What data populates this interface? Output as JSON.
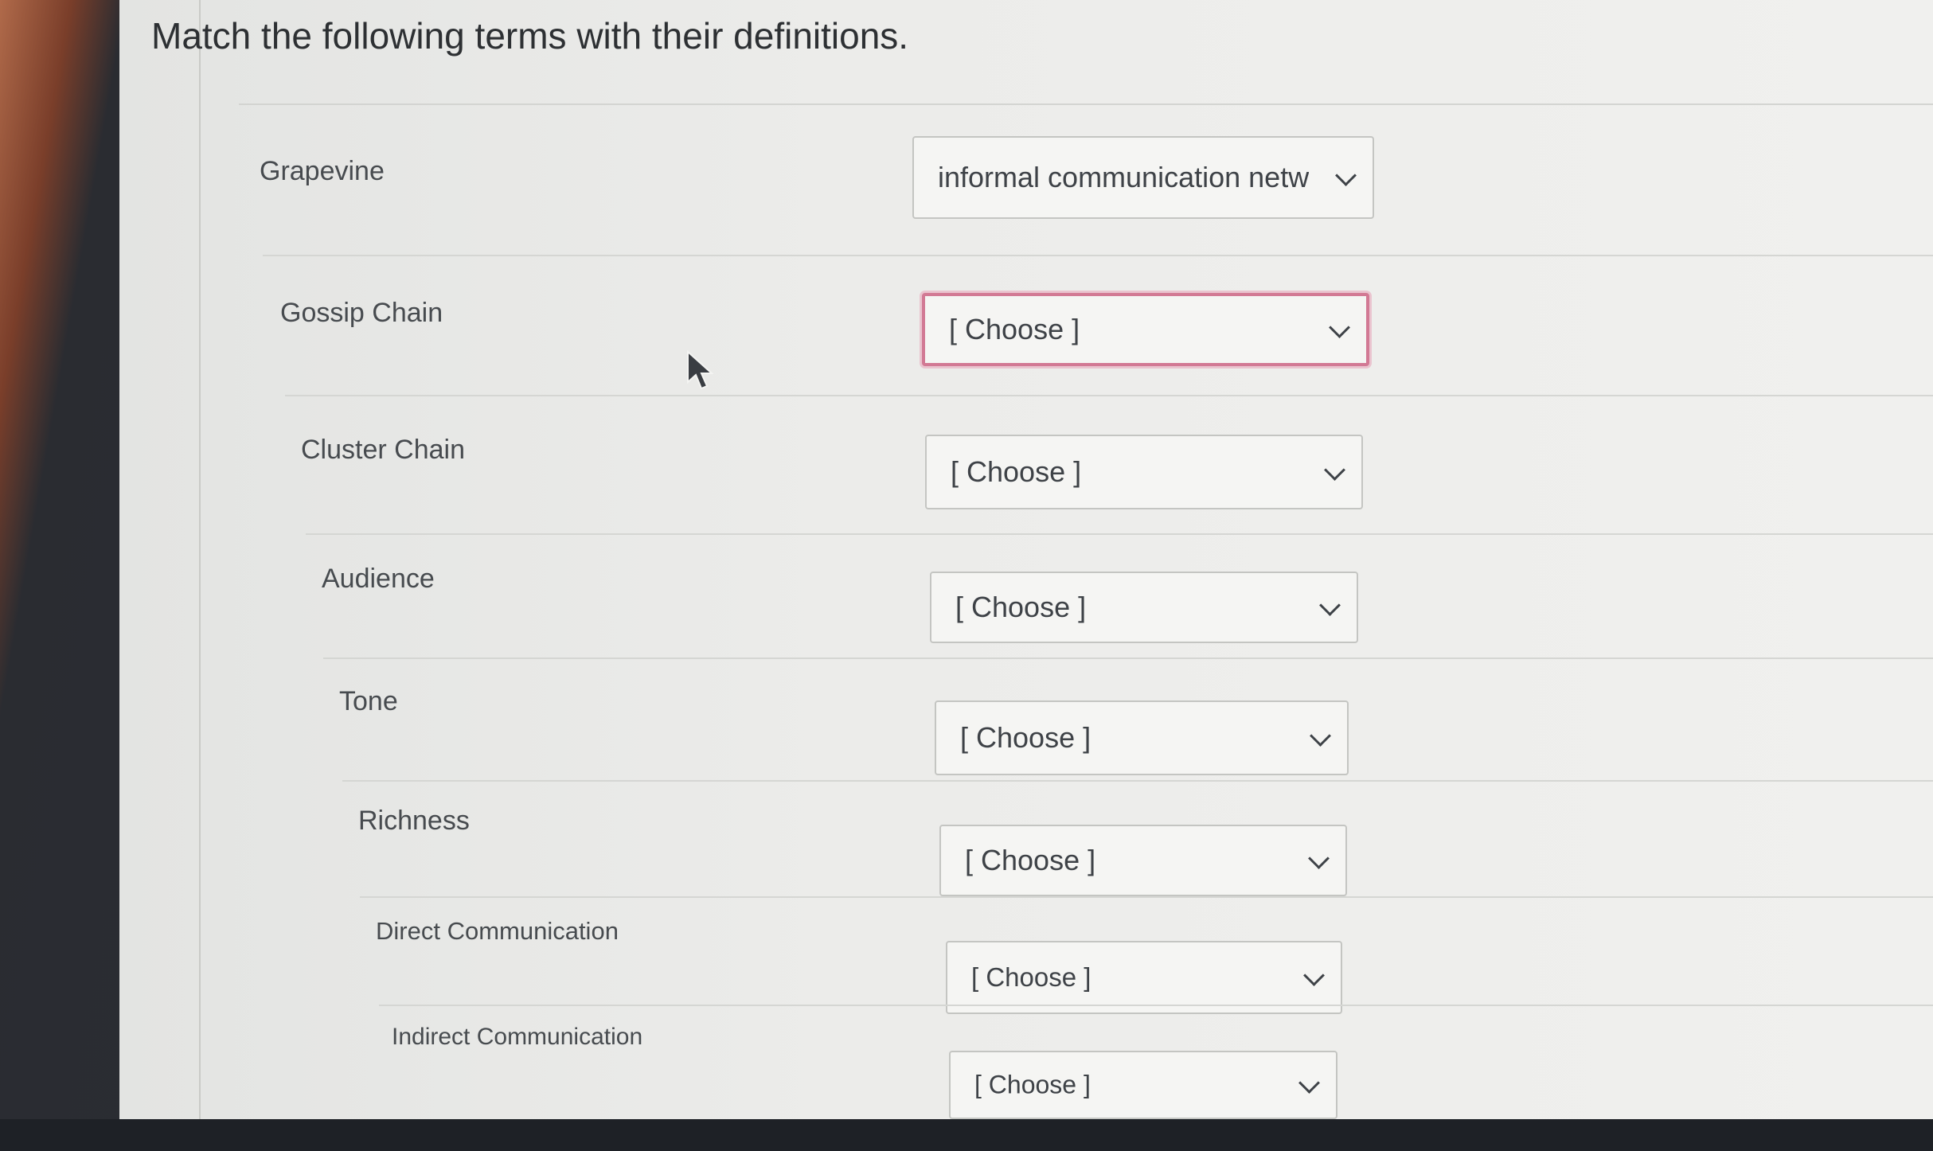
{
  "question": {
    "prompt": "Match the following terms with their definitions."
  },
  "rows": [
    {
      "term": "Grapevine",
      "selected": "informal communication netw"
    },
    {
      "term": "Gossip Chain",
      "selected": "[ Choose ]"
    },
    {
      "term": "Cluster Chain",
      "selected": "[ Choose ]"
    },
    {
      "term": "Audience",
      "selected": "[ Choose ]"
    },
    {
      "term": "Tone",
      "selected": "[ Choose ]"
    },
    {
      "term": "Richness",
      "selected": "[ Choose ]"
    },
    {
      "term": "Direct Communication",
      "selected": "[ Choose ]"
    },
    {
      "term": "Indirect Communication",
      "selected": "[ Choose ]"
    }
  ],
  "icons": {
    "dropdown": "chevron-down-icon",
    "pointer": "mouse-cursor-icon"
  },
  "colors": {
    "invalid_border": "#d27994"
  }
}
